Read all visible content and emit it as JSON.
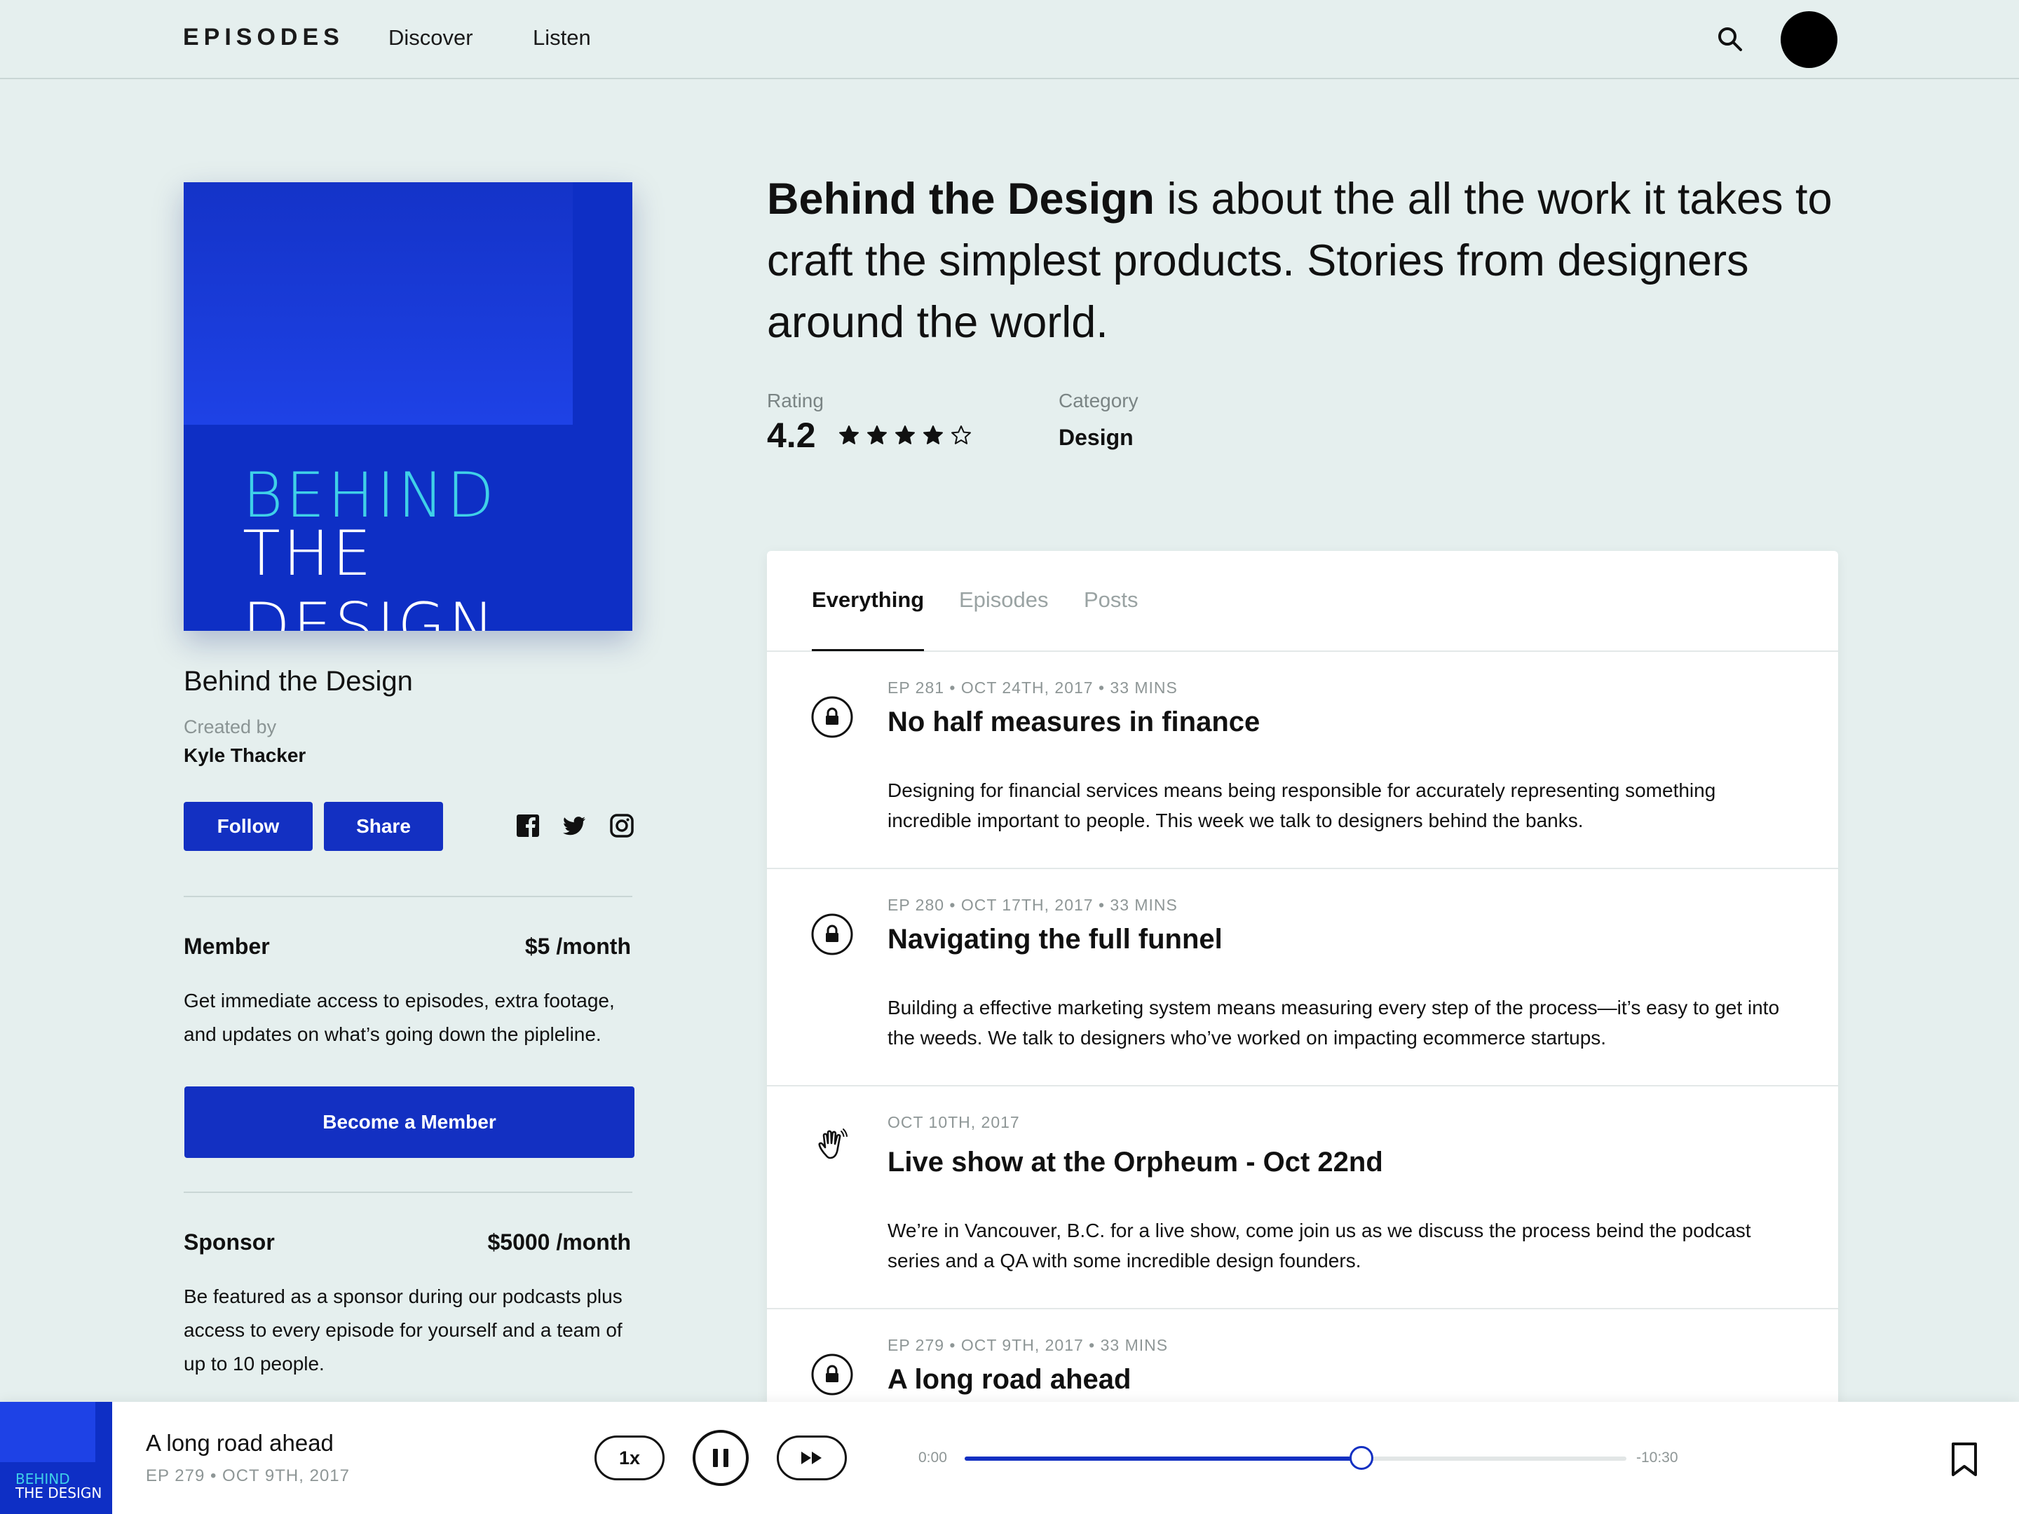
{
  "nav": {
    "logo": "EPISODES",
    "links": [
      "Discover",
      "Listen"
    ]
  },
  "show": {
    "cover_line1": "BEHIND",
    "cover_line2": "THE DESIGN",
    "title": "Behind the Design",
    "created_by_label": "Created by",
    "creator": "Kyle Thacker",
    "follow_label": "Follow",
    "share_label": "Share",
    "headline_bold": "Behind the Design",
    "headline_rest": " is about the all the work it takes to craft the simplest products. Stories from designers around the world.",
    "rating_label": "Rating",
    "rating_value": "4.2",
    "stars_filled": 4,
    "stars_total": 5,
    "category_label": "Category",
    "category_value": "Design"
  },
  "tiers": [
    {
      "name": "Member",
      "price": "$5 /month",
      "description": "Get immediate access to episodes, extra footage, and updates on what’s going down the pipleline.",
      "cta": "Become a Member"
    },
    {
      "name": "Sponsor",
      "price": "$5000 /month",
      "description": "Be featured as a sponsor during our podcasts plus access to every episode for yourself and a team of up to 10 people."
    }
  ],
  "tabs": [
    "Everything",
    "Episodes",
    "Posts"
  ],
  "feed": [
    {
      "icon": "lock-icon",
      "meta": "EP 281  •  OCT 24TH, 2017  •  33 MINS",
      "title": "No half measures in finance",
      "desc": "Designing for financial services means being responsible for accurately representing something incredible important to people. This week we talk to designers behind the banks."
    },
    {
      "icon": "lock-icon",
      "meta": "EP 280  •  OCT 17TH, 2017  •  33 MINS",
      "title": "Navigating the full funnel",
      "desc": "Building a effective marketing system means measuring every step of the process—it’s easy to get into the weeds. We talk to designers who’ve worked on impacting ecommerce startups."
    },
    {
      "icon": "wave-hand-icon",
      "meta": "OCT 10TH, 2017",
      "title": "Live show at the Orpheum - Oct 22nd",
      "desc": "We’re in Vancouver, B.C. for a live show, come join us as we discuss the process beind the podcast series and a QA with some incredible design founders."
    },
    {
      "icon": "lock-icon",
      "meta": "EP 279  •  OCT 9TH, 2017  •  33 MINS",
      "title": "A long road ahead",
      "desc": ""
    }
  ],
  "player": {
    "cover_line1": "BEHIND",
    "cover_line2": "THE DESIGN",
    "title": "A long road ahead",
    "meta": "EP 279  •  OCT 9TH, 2017",
    "speed": "1x",
    "time_current": "0:00",
    "time_remaining": "-10:30",
    "progress": 0.6
  },
  "colors": {
    "accent": "#1330c2",
    "background": "#e5efee",
    "cover_cyan": "#3fd0e8"
  }
}
